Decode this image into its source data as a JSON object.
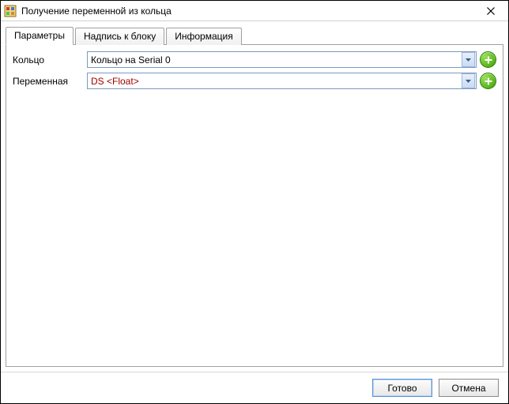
{
  "window": {
    "title": "Получение переменной из кольца"
  },
  "tabs": {
    "params": "Параметры",
    "caption": "Надпись к блоку",
    "info": "Информация"
  },
  "form": {
    "ring_label": "Кольцо",
    "ring_value": "Кольцо  на Serial 0",
    "var_label": "Переменная",
    "var_value": "DS <Float>"
  },
  "buttons": {
    "ok": "Готово",
    "cancel": "Отмена"
  }
}
